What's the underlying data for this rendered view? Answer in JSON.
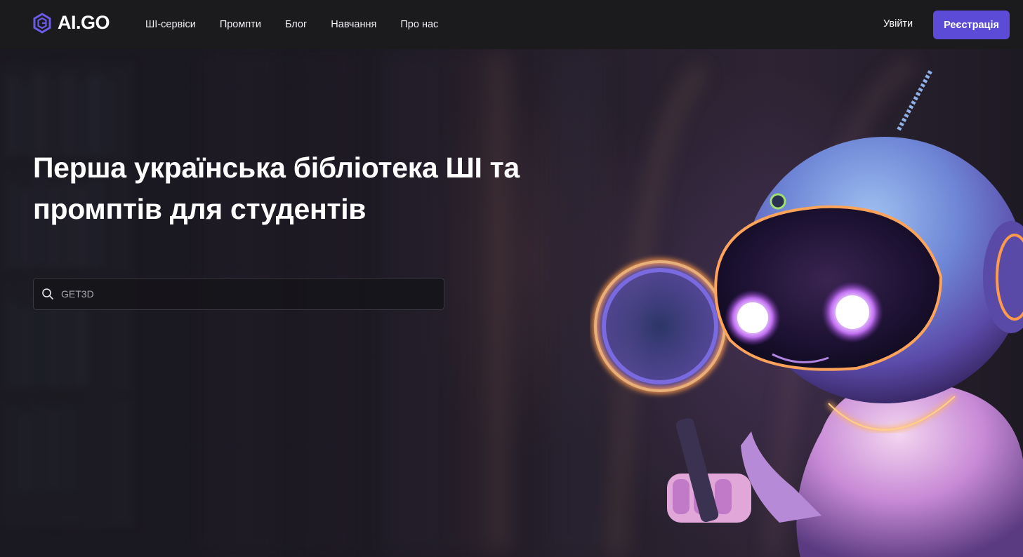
{
  "header": {
    "brand": "AI.GO",
    "nav": [
      {
        "label": "ШІ-сервіси"
      },
      {
        "label": "Промпти"
      },
      {
        "label": "Блог"
      },
      {
        "label": "Навчання"
      },
      {
        "label": "Про нас"
      }
    ],
    "login_label": "Увійти",
    "signup_label": "Реєстрація"
  },
  "hero": {
    "title": "Перша українська бібліотека ШІ та промптів для студентів",
    "search": {
      "placeholder": "GET3D",
      "value": ""
    }
  },
  "icons": {
    "logo": "hexagon-logo-icon",
    "search": "search-icon"
  },
  "colors": {
    "accent": "#5b4bd6",
    "header_bg": "#1b1a1d",
    "logo_purple": "#6b5ce7"
  }
}
